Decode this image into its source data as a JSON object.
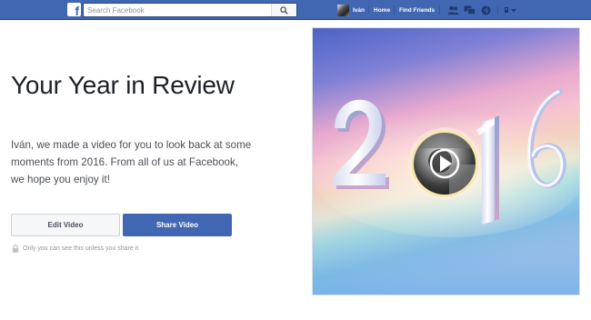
{
  "topbar": {
    "logo_letter": "f",
    "search_placeholder": "Search Facebook",
    "user_name": "Iván",
    "nav_home": "Home",
    "nav_find_friends": "Find Friends",
    "icons": [
      "friend-requests-icon",
      "messages-icon",
      "notifications-icon",
      "account-menu-icon"
    ]
  },
  "main": {
    "title": "Your Year in Review",
    "description": "Iván, we made a video for you to look back at some moments from 2016. From all of us at Facebook, we hope you enjoy it!",
    "edit_button": "Edit Video",
    "share_button": "Share Video",
    "privacy_note": "Only you can see this unless you share it"
  },
  "video": {
    "year_digits": [
      "2",
      "0",
      "1",
      "6"
    ],
    "play_icon": "play-icon"
  },
  "colors": {
    "brand_blue": "#4267b2",
    "brand_blue_dark": "#29487d",
    "text_dark": "#1d2129",
    "text_body": "#4b4f56",
    "text_muted": "#90949c"
  }
}
